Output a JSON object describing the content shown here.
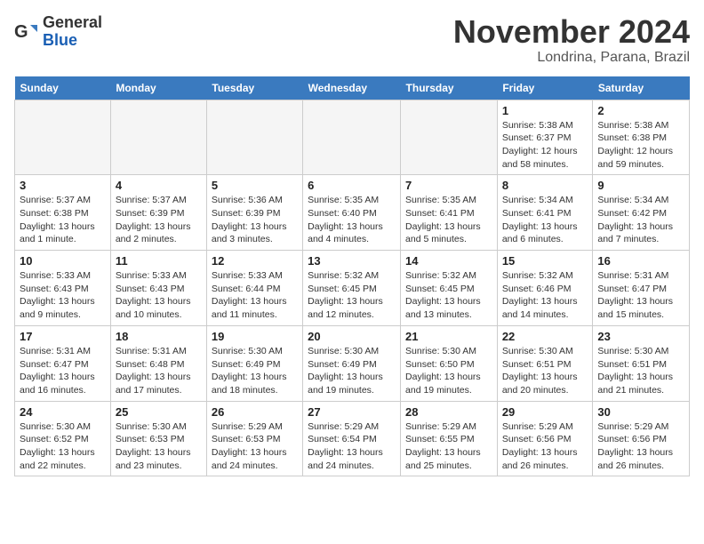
{
  "logo": {
    "general": "General",
    "blue": "Blue"
  },
  "title": "November 2024",
  "subtitle": "Londrina, Parana, Brazil",
  "headers": [
    "Sunday",
    "Monday",
    "Tuesday",
    "Wednesday",
    "Thursday",
    "Friday",
    "Saturday"
  ],
  "weeks": [
    [
      {
        "day": "",
        "info": ""
      },
      {
        "day": "",
        "info": ""
      },
      {
        "day": "",
        "info": ""
      },
      {
        "day": "",
        "info": ""
      },
      {
        "day": "",
        "info": ""
      },
      {
        "day": "1",
        "info": "Sunrise: 5:38 AM\nSunset: 6:37 PM\nDaylight: 12 hours and 58 minutes."
      },
      {
        "day": "2",
        "info": "Sunrise: 5:38 AM\nSunset: 6:38 PM\nDaylight: 12 hours and 59 minutes."
      }
    ],
    [
      {
        "day": "3",
        "info": "Sunrise: 5:37 AM\nSunset: 6:38 PM\nDaylight: 13 hours and 1 minute."
      },
      {
        "day": "4",
        "info": "Sunrise: 5:37 AM\nSunset: 6:39 PM\nDaylight: 13 hours and 2 minutes."
      },
      {
        "day": "5",
        "info": "Sunrise: 5:36 AM\nSunset: 6:39 PM\nDaylight: 13 hours and 3 minutes."
      },
      {
        "day": "6",
        "info": "Sunrise: 5:35 AM\nSunset: 6:40 PM\nDaylight: 13 hours and 4 minutes."
      },
      {
        "day": "7",
        "info": "Sunrise: 5:35 AM\nSunset: 6:41 PM\nDaylight: 13 hours and 5 minutes."
      },
      {
        "day": "8",
        "info": "Sunrise: 5:34 AM\nSunset: 6:41 PM\nDaylight: 13 hours and 6 minutes."
      },
      {
        "day": "9",
        "info": "Sunrise: 5:34 AM\nSunset: 6:42 PM\nDaylight: 13 hours and 7 minutes."
      }
    ],
    [
      {
        "day": "10",
        "info": "Sunrise: 5:33 AM\nSunset: 6:43 PM\nDaylight: 13 hours and 9 minutes."
      },
      {
        "day": "11",
        "info": "Sunrise: 5:33 AM\nSunset: 6:43 PM\nDaylight: 13 hours and 10 minutes."
      },
      {
        "day": "12",
        "info": "Sunrise: 5:33 AM\nSunset: 6:44 PM\nDaylight: 13 hours and 11 minutes."
      },
      {
        "day": "13",
        "info": "Sunrise: 5:32 AM\nSunset: 6:45 PM\nDaylight: 13 hours and 12 minutes."
      },
      {
        "day": "14",
        "info": "Sunrise: 5:32 AM\nSunset: 6:45 PM\nDaylight: 13 hours and 13 minutes."
      },
      {
        "day": "15",
        "info": "Sunrise: 5:32 AM\nSunset: 6:46 PM\nDaylight: 13 hours and 14 minutes."
      },
      {
        "day": "16",
        "info": "Sunrise: 5:31 AM\nSunset: 6:47 PM\nDaylight: 13 hours and 15 minutes."
      }
    ],
    [
      {
        "day": "17",
        "info": "Sunrise: 5:31 AM\nSunset: 6:47 PM\nDaylight: 13 hours and 16 minutes."
      },
      {
        "day": "18",
        "info": "Sunrise: 5:31 AM\nSunset: 6:48 PM\nDaylight: 13 hours and 17 minutes."
      },
      {
        "day": "19",
        "info": "Sunrise: 5:30 AM\nSunset: 6:49 PM\nDaylight: 13 hours and 18 minutes."
      },
      {
        "day": "20",
        "info": "Sunrise: 5:30 AM\nSunset: 6:49 PM\nDaylight: 13 hours and 19 minutes."
      },
      {
        "day": "21",
        "info": "Sunrise: 5:30 AM\nSunset: 6:50 PM\nDaylight: 13 hours and 19 minutes."
      },
      {
        "day": "22",
        "info": "Sunrise: 5:30 AM\nSunset: 6:51 PM\nDaylight: 13 hours and 20 minutes."
      },
      {
        "day": "23",
        "info": "Sunrise: 5:30 AM\nSunset: 6:51 PM\nDaylight: 13 hours and 21 minutes."
      }
    ],
    [
      {
        "day": "24",
        "info": "Sunrise: 5:30 AM\nSunset: 6:52 PM\nDaylight: 13 hours and 22 minutes."
      },
      {
        "day": "25",
        "info": "Sunrise: 5:30 AM\nSunset: 6:53 PM\nDaylight: 13 hours and 23 minutes."
      },
      {
        "day": "26",
        "info": "Sunrise: 5:29 AM\nSunset: 6:53 PM\nDaylight: 13 hours and 24 minutes."
      },
      {
        "day": "27",
        "info": "Sunrise: 5:29 AM\nSunset: 6:54 PM\nDaylight: 13 hours and 24 minutes."
      },
      {
        "day": "28",
        "info": "Sunrise: 5:29 AM\nSunset: 6:55 PM\nDaylight: 13 hours and 25 minutes."
      },
      {
        "day": "29",
        "info": "Sunrise: 5:29 AM\nSunset: 6:56 PM\nDaylight: 13 hours and 26 minutes."
      },
      {
        "day": "30",
        "info": "Sunrise: 5:29 AM\nSunset: 6:56 PM\nDaylight: 13 hours and 26 minutes."
      }
    ]
  ]
}
